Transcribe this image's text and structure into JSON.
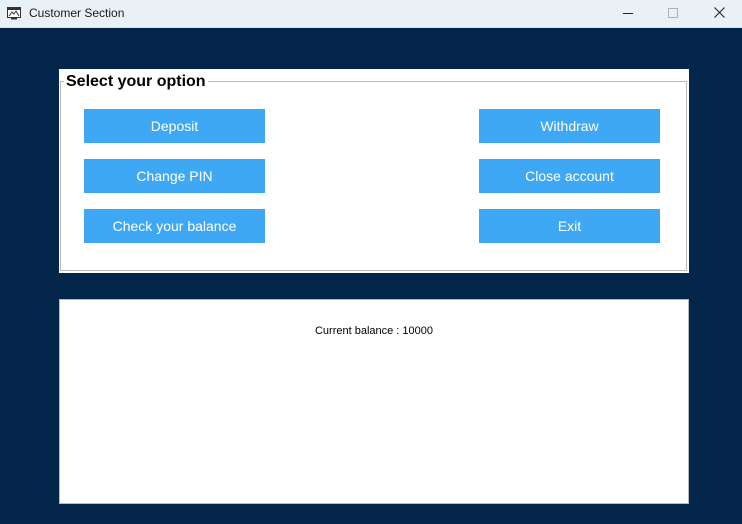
{
  "window": {
    "title": "Customer Section"
  },
  "options": {
    "legend": "Select your option",
    "deposit_label": "Deposit",
    "change_pin_label": "Change PIN",
    "check_balance_label": "Check your balance",
    "withdraw_label": "Withdraw",
    "close_account_label": "Close account",
    "exit_label": "Exit"
  },
  "output": {
    "balance_text": "Current balance : 10000"
  },
  "colors": {
    "background": "#03264a",
    "button": "#3fa8f5",
    "titlebar": "#e9f1f6"
  },
  "icons": {
    "app": "app-window-icon",
    "minimize": "minimize-icon",
    "maximize": "maximize-icon",
    "close": "close-icon"
  }
}
